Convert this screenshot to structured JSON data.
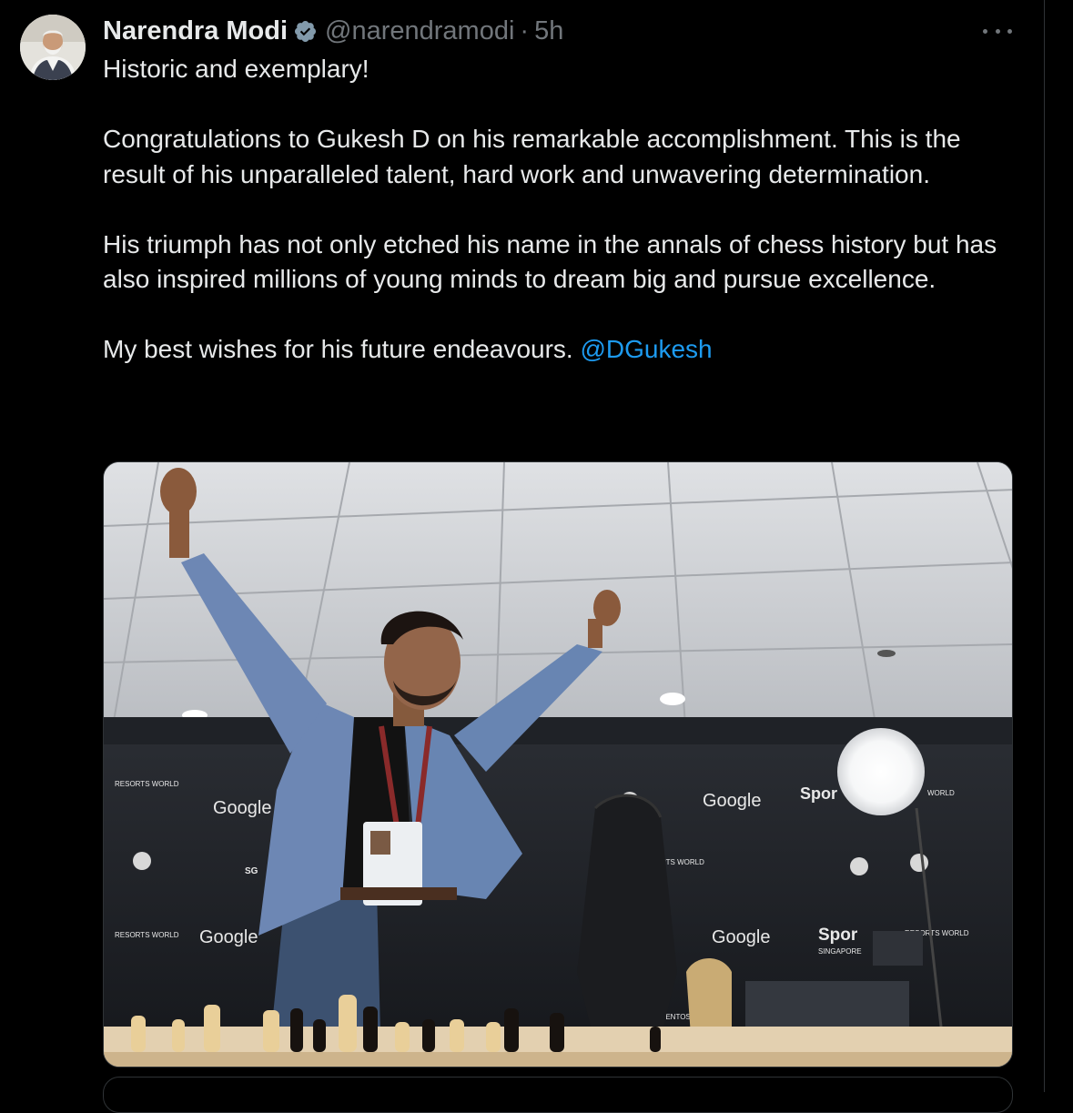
{
  "tweet": {
    "author": {
      "display_name": "Narendra Modi",
      "handle": "@narendramodi",
      "verified": true,
      "verified_color": "#829aab"
    },
    "separator": "·",
    "time": "5h",
    "more_icon": "more-horizontal-icon",
    "text": {
      "line1": "Historic and exemplary!",
      "para2": "Congratulations to Gukesh D on his remarkable accomplishment. This is the result of his unparalleled talent, hard work and unwavering determination.",
      "para3": "His triumph has not only etched his name in the annals of chess history but has also inspired millions of young minds to dream big and pursue excellence.",
      "para4": "My best wishes for his future endeavours.",
      "mention": "@DGukesh"
    },
    "media": {
      "sponsor_texts": {
        "google_1": "Google",
        "google_2": "Google",
        "google_3": "Google",
        "google_4": "Google",
        "sport_1": "Spor",
        "sport_2": "Spor",
        "singapore": "SINGAPORE",
        "resorts_1": "RESORTS WORLD",
        "resorts_2": "RESORTS WORLD",
        "resorts_3": "RTS WORLD",
        "resorts_4": "RESORTS WORLD",
        "world_1": "WORLD",
        "sentosa": "SENTOSA",
        "sg": "SG"
      }
    }
  },
  "colors": {
    "background": "#000000",
    "text": "#e7e9ea",
    "secondary": "#71767b",
    "link": "#1d9bf0",
    "border": "#2f3336"
  }
}
